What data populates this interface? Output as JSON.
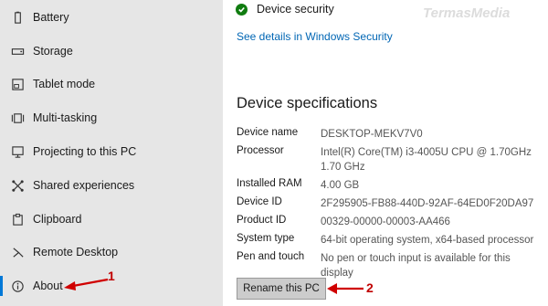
{
  "sidebar": {
    "items": [
      {
        "label": "Battery",
        "icon": "battery-icon"
      },
      {
        "label": "Storage",
        "icon": "storage-icon"
      },
      {
        "label": "Tablet mode",
        "icon": "tablet-mode-icon"
      },
      {
        "label": "Multi-tasking",
        "icon": "multitasking-icon"
      },
      {
        "label": "Projecting to this PC",
        "icon": "projecting-icon"
      },
      {
        "label": "Shared experiences",
        "icon": "shared-experiences-icon"
      },
      {
        "label": "Clipboard",
        "icon": "clipboard-icon"
      },
      {
        "label": "Remote Desktop",
        "icon": "remote-desktop-icon"
      },
      {
        "label": "About",
        "icon": "info-icon",
        "selected": true
      }
    ]
  },
  "security": {
    "title": "Device security",
    "link": "See details in Windows Security"
  },
  "specs": {
    "heading": "Device specifications",
    "rows": [
      {
        "label": "Device name",
        "value": "DESKTOP-MEKV7V0"
      },
      {
        "label": "Processor",
        "value": "Intel(R) Core(TM) i3-4005U CPU @ 1.70GHz   1.70 GHz"
      },
      {
        "label": "Installed RAM",
        "value": "4.00 GB"
      },
      {
        "label": "Device ID",
        "value": "2F295905-FB88-440D-92AF-64ED0F20DA97"
      },
      {
        "label": "Product ID",
        "value": "00329-00000-00003-AA466"
      },
      {
        "label": "System type",
        "value": "64-bit operating system, x64-based processor"
      },
      {
        "label": "Pen and touch",
        "value": "No pen or touch input is available for this display"
      }
    ],
    "rename_button": "Rename this PC"
  },
  "watermark": "TermasMedia",
  "annotations": {
    "one": "1",
    "two": "2"
  },
  "colors": {
    "sidebar_bg": "#e6e6e6",
    "accent": "#0078d7",
    "link": "#0066b4",
    "check": "#107c10",
    "annotation": "#c00000"
  }
}
